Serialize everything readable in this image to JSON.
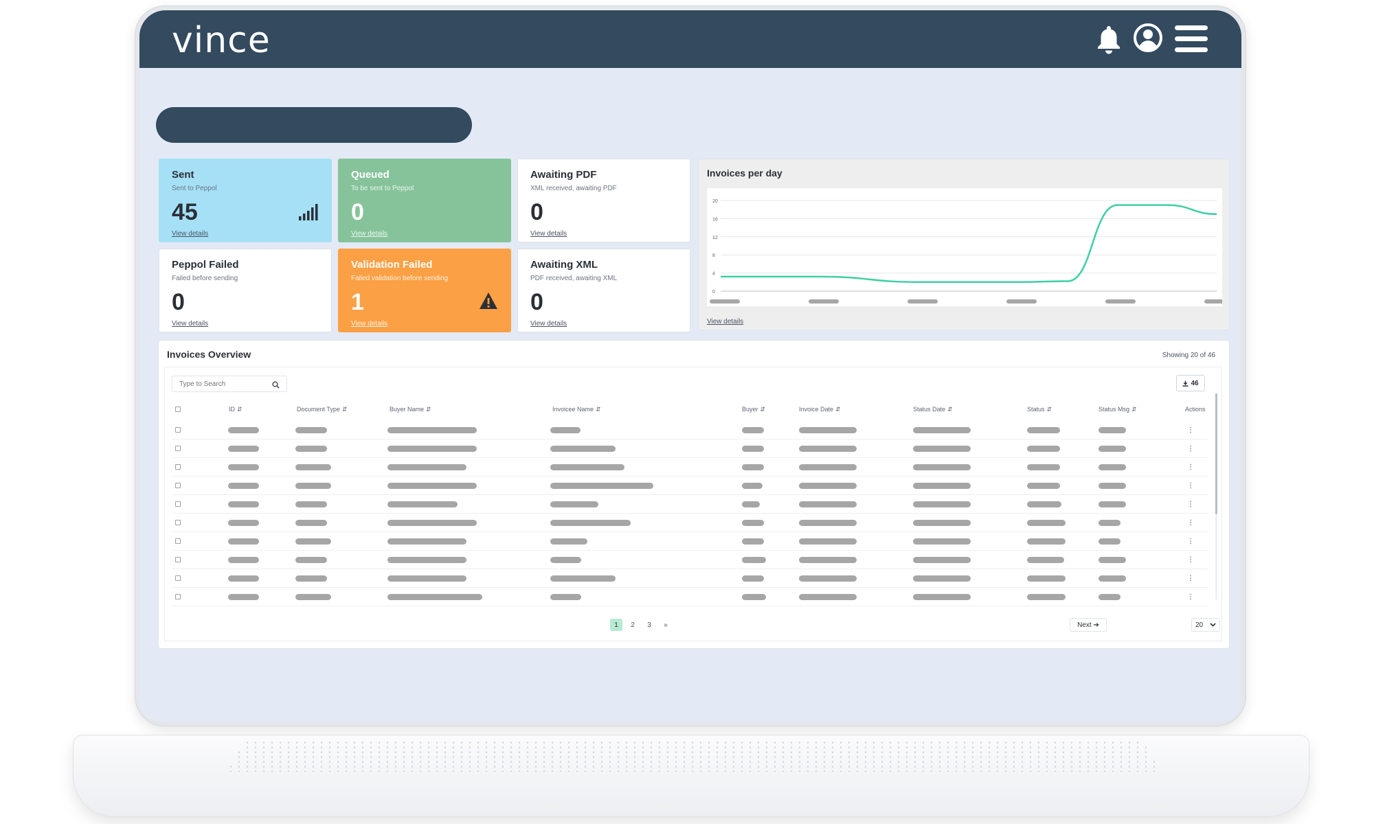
{
  "app": {
    "logo": "vince"
  },
  "header_icons": [
    "bell-icon",
    "user-account-icon",
    "hamburger-menu-icon"
  ],
  "colors": {
    "header": "#334a5f",
    "screen_bg": "#e3eaf5",
    "sent": "#a5e0f7",
    "queued": "#86c39b",
    "validation_failed": "#fba044",
    "chart_line": "#3ecfa2",
    "active_page": "#b6ead2"
  },
  "cards": [
    {
      "title": "Sent",
      "subtitle": "Sent to Peppol",
      "value": "45",
      "link": "View details",
      "icon": "signal-bars-icon"
    },
    {
      "title": "Queued",
      "subtitle": "To be sent to Peppol",
      "value": "0",
      "link": "View details"
    },
    {
      "title": "Awaiting PDF",
      "subtitle": "XML received, awaiting PDF",
      "value": "0",
      "link": "View details"
    },
    {
      "title": "Peppol Failed",
      "subtitle": "Failed before sending",
      "value": "0",
      "link": "View details"
    },
    {
      "title": "Validation Failed",
      "subtitle": "Failed validation before sending",
      "value": "1",
      "link": "View details",
      "icon": "warning-icon"
    },
    {
      "title": "Awaiting XML",
      "subtitle": "PDF received, awaiting XML",
      "value": "0",
      "link": "View details"
    }
  ],
  "chart": {
    "title": "Invoices per day",
    "link": "View details"
  },
  "chart_data": {
    "type": "line",
    "title": "Invoices per day",
    "y_ticks": [
      "20",
      "16",
      "12",
      "8",
      "4",
      "0"
    ],
    "ylim": [
      0,
      20
    ],
    "x_labels_hidden": true,
    "series": [
      {
        "x": [
          0,
          0.2,
          0.4,
          0.6,
          0.7,
          0.8,
          0.9,
          1.0
        ],
        "values": [
          3.2,
          3.2,
          2.0,
          2.0,
          2.2,
          19.0,
          19.0,
          17.0
        ]
      }
    ],
    "grid": true
  },
  "table": {
    "title": "Invoices Overview",
    "showing": "Showing 20 of 46",
    "search_placeholder": "Type to Search",
    "export_label": "46",
    "columns": [
      "ID",
      "Document Type",
      "Buyer Name",
      "Invoicee Name",
      "Buyer",
      "Invoice Date",
      "Status Date",
      "Status",
      "Status Msg",
      "Actions"
    ],
    "sort_glyph": "⇵",
    "actions_glyph": "⋮",
    "rows_placeholder_widths": [
      [
        45,
        46,
        130,
        44,
        32,
        84,
        84,
        48,
        40
      ],
      [
        45,
        46,
        130,
        95,
        32,
        84,
        84,
        48,
        40
      ],
      [
        45,
        52,
        115,
        108,
        32,
        84,
        84,
        48,
        40
      ],
      [
        45,
        52,
        130,
        150,
        30,
        84,
        84,
        48,
        40
      ],
      [
        45,
        46,
        102,
        70,
        26,
        84,
        84,
        50,
        40
      ],
      [
        45,
        46,
        130,
        117,
        32,
        84,
        84,
        56,
        32
      ],
      [
        45,
        52,
        115,
        54,
        32,
        84,
        84,
        56,
        32
      ],
      [
        45,
        46,
        115,
        45,
        35,
        84,
        84,
        54,
        40
      ],
      [
        45,
        46,
        115,
        95,
        32,
        84,
        84,
        56,
        40
      ],
      [
        45,
        52,
        138,
        45,
        35,
        84,
        84,
        56,
        32
      ]
    ],
    "pagination": {
      "pages": [
        "1",
        "2",
        "3"
      ],
      "current": "1",
      "next_arrow": "»",
      "next_label": "Next ➔",
      "per_page": "20"
    }
  }
}
